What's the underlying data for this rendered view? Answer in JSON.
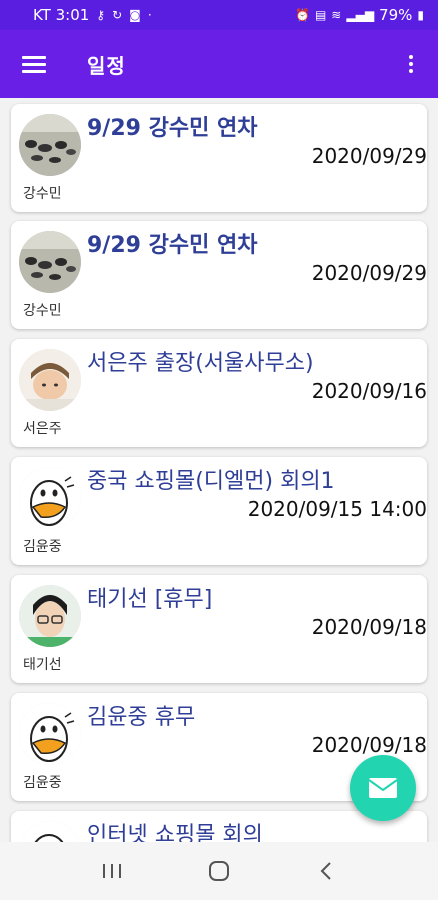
{
  "status_bar": {
    "carrier_time": "KT 3:01",
    "battery": "79%"
  },
  "app_bar": {
    "title": "일정",
    "menu_icon": "hamburger-menu-icon",
    "more_icon": "more-vert-icon"
  },
  "schedules": [
    {
      "title": "9/29 강수민 연차",
      "date": "2020/09/29",
      "author": "강수민",
      "avatar": "photo-avatar"
    },
    {
      "title": "9/29 강수민 연차",
      "date": "2020/09/29",
      "author": "강수민",
      "avatar": "photo-avatar"
    },
    {
      "title": "서은주 출장(서울사무소)",
      "date": "2020/09/16",
      "author": "서은주",
      "avatar": "photo-avatar"
    },
    {
      "title": "중국 쇼핑몰(디엘먼) 회의1",
      "date": "2020/09/15 14:00",
      "author": "김윤중",
      "avatar": "duck-avatar"
    },
    {
      "title": "태기선 [휴무]",
      "date": "2020/09/18",
      "author": "태기선",
      "avatar": "photo-avatar"
    },
    {
      "title": "김윤중 휴무",
      "date": "2020/09/18",
      "author": "김윤중",
      "avatar": "duck-avatar"
    },
    {
      "title": "인터넷 쇼핑몰 회의",
      "date": "",
      "author": "",
      "avatar": "duck-avatar"
    }
  ],
  "fab": {
    "icon": "mail-icon",
    "color": "#22d4b0"
  },
  "nav_bar": {
    "recents_icon": "recents-icon",
    "home_icon": "home-icon",
    "back_icon": "back-icon"
  },
  "colors": {
    "app_bar": "#6a1fe6",
    "title_text": "#2f3e97"
  }
}
